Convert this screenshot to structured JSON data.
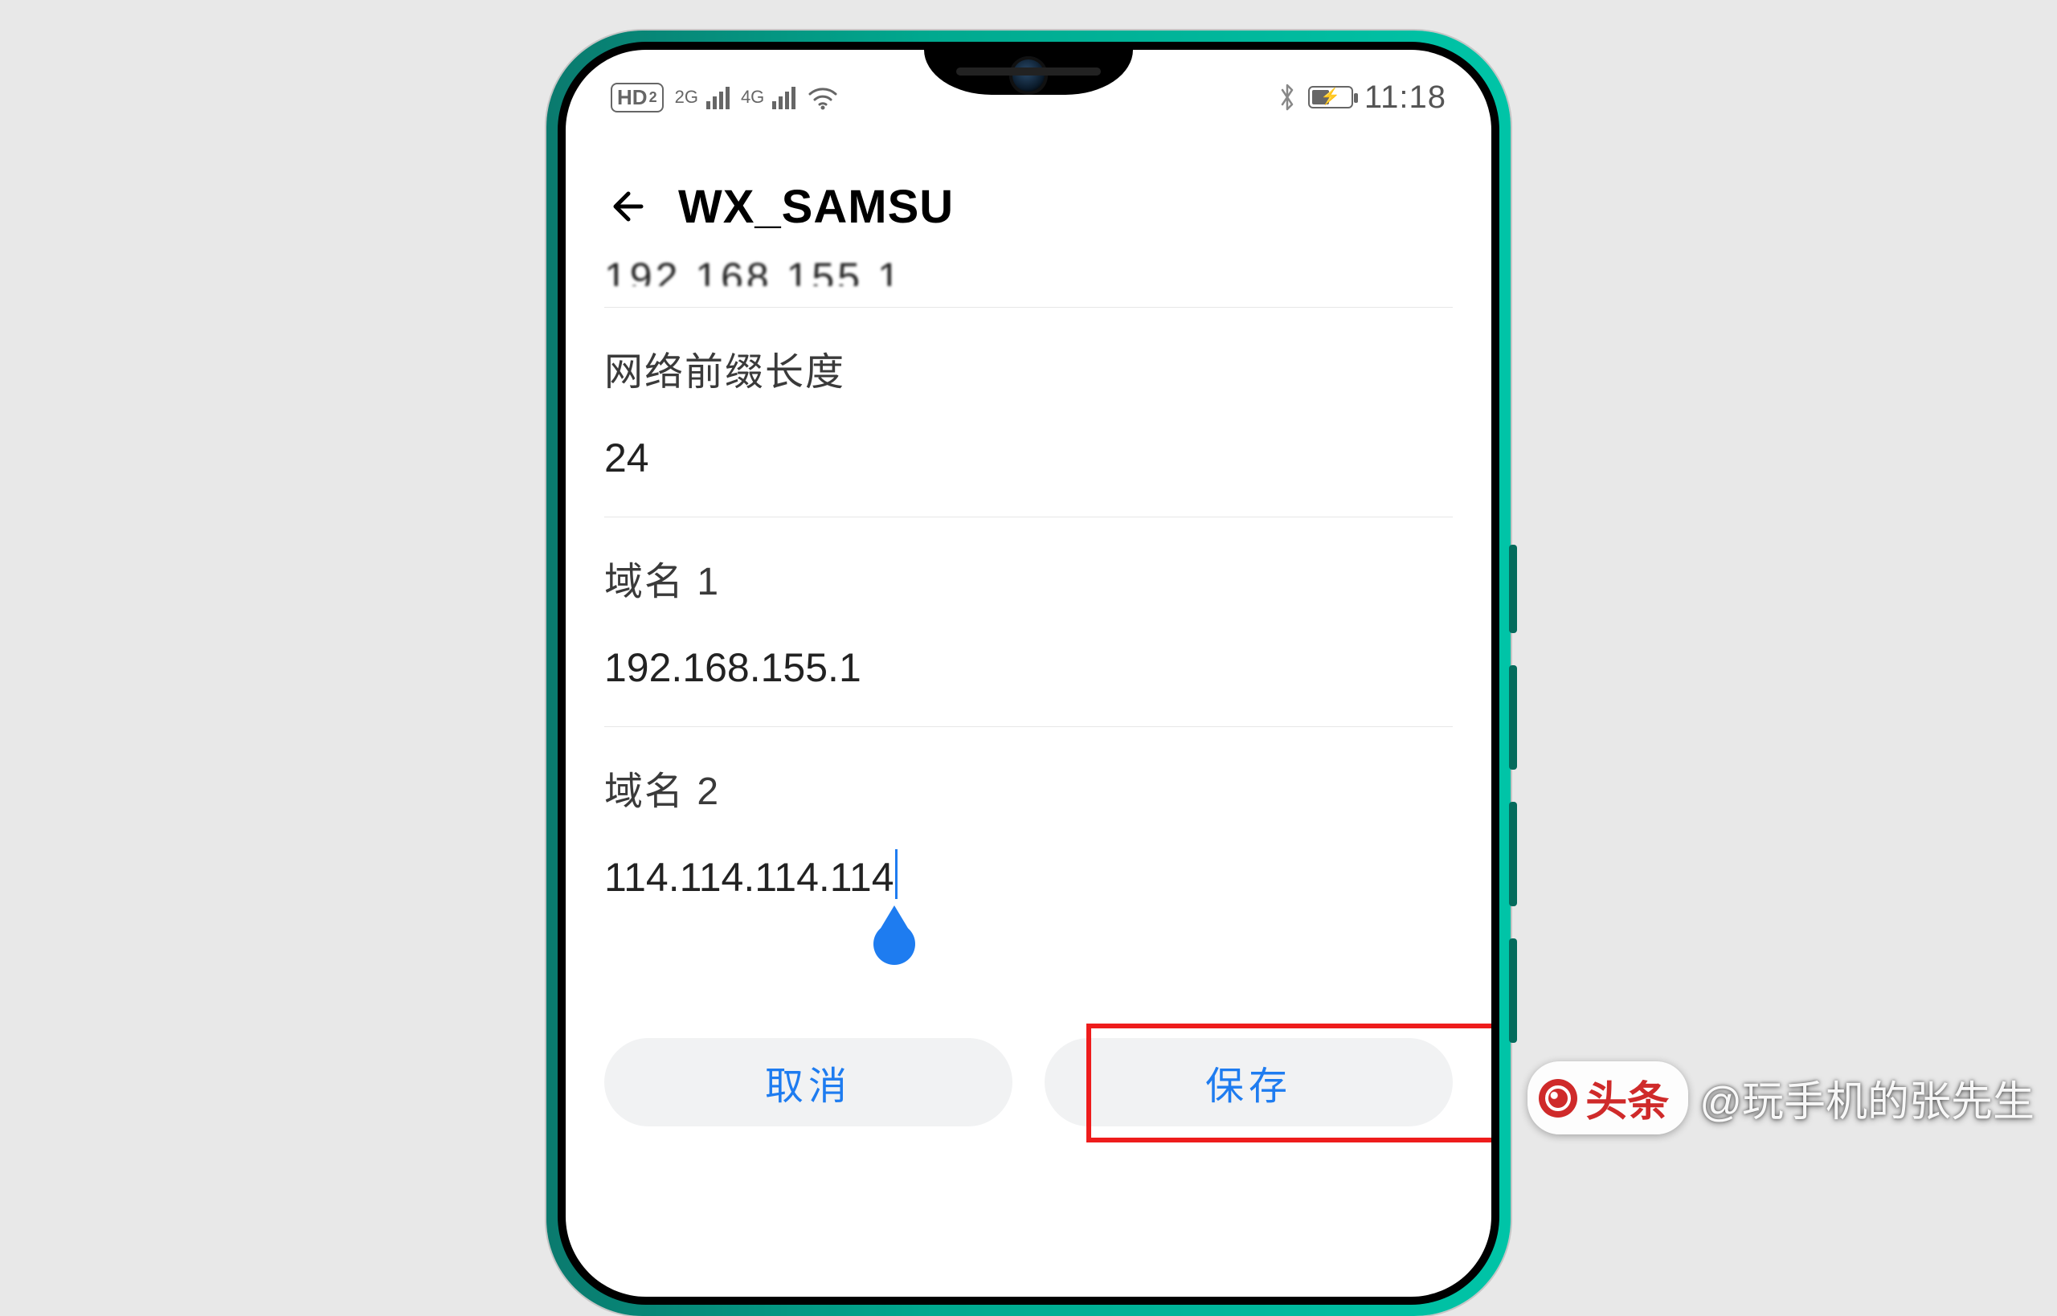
{
  "status": {
    "hd_label": "HD",
    "hd_sub": "2",
    "net1_label": "2G",
    "net2_label": "4G",
    "time": "11:18"
  },
  "header": {
    "title": "WX_SAMSU"
  },
  "fields": {
    "cutoff_value": "192.168.155.1",
    "prefix_label": "网络前缀长度",
    "prefix_value": "24",
    "dns1_label": "域名 1",
    "dns1_value": "192.168.155.1",
    "dns2_label": "域名 2",
    "dns2_value": "114.114.114.114"
  },
  "buttons": {
    "cancel": "取消",
    "save": "保存"
  },
  "watermark": {
    "badge": "头条",
    "author": "@玩手机的张先生"
  }
}
